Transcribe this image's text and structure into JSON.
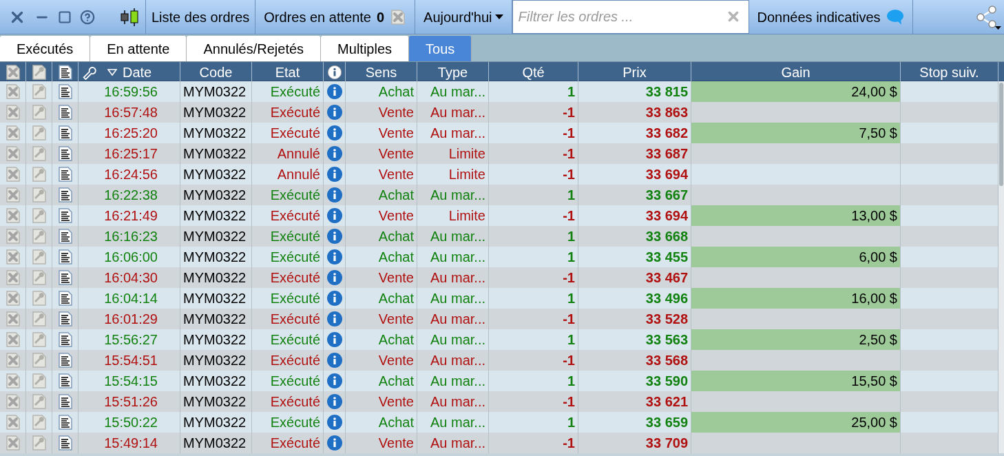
{
  "toolbar": {
    "title": "Liste des ordres",
    "pending_label": "Ordres en attente",
    "pending_count": "0",
    "period": "Aujourd'hui",
    "filter": {
      "placeholder": "Filtrer les ordres ..."
    },
    "data_note": "Données indicatives"
  },
  "tabs": [
    {
      "label": "Exécutés",
      "selected": false
    },
    {
      "label": "En attente",
      "selected": false
    },
    {
      "label": "Annulés/Rejetés",
      "selected": false
    },
    {
      "label": "Multiples",
      "selected": false
    },
    {
      "label": "Tous",
      "selected": true
    }
  ],
  "table": {
    "columns": [
      "Date",
      "Code",
      "Etat",
      "Sens",
      "Type",
      "Qté",
      "Prix",
      "Gain",
      "Stop suiv."
    ],
    "rows": [
      {
        "time": "16:59:56",
        "code": "MYM0322",
        "state": "Exécuté",
        "side": "Achat",
        "type": "Au mar...",
        "qty": "1",
        "price": "33 815",
        "gain": "24,00 $",
        "color": "#11820f"
      },
      {
        "time": "16:57:48",
        "code": "MYM0322",
        "state": "Exécuté",
        "side": "Vente",
        "type": "Au mar...",
        "qty": "-1",
        "price": "33 863",
        "color": "#b0100f"
      },
      {
        "time": "16:25:20",
        "code": "MYM0322",
        "state": "Exécuté",
        "side": "Vente",
        "type": "Au mar...",
        "qty": "-1",
        "price": "33 682",
        "gain": "7,50 $",
        "color": "#b0100f"
      },
      {
        "time": "16:25:17",
        "code": "MYM0322",
        "state": "Annulé",
        "side": "Vente",
        "type": "Limite",
        "qty": "-1",
        "price": "33 687",
        "color": "#b0100f"
      },
      {
        "time": "16:24:56",
        "code": "MYM0322",
        "state": "Annulé",
        "side": "Vente",
        "type": "Limite",
        "qty": "-1",
        "price": "33 694",
        "color": "#b0100f"
      },
      {
        "time": "16:22:38",
        "code": "MYM0322",
        "state": "Exécuté",
        "side": "Achat",
        "type": "Au mar...",
        "qty": "1",
        "price": "33 667",
        "color": "#11820f"
      },
      {
        "time": "16:21:49",
        "code": "MYM0322",
        "state": "Exécuté",
        "side": "Vente",
        "type": "Limite",
        "qty": "-1",
        "price": "33 694",
        "gain": "13,00 $",
        "color": "#b0100f"
      },
      {
        "time": "16:16:23",
        "code": "MYM0322",
        "state": "Exécuté",
        "side": "Achat",
        "type": "Au mar...",
        "qty": "1",
        "price": "33 668",
        "color": "#11820f"
      },
      {
        "time": "16:06:00",
        "code": "MYM0322",
        "state": "Exécuté",
        "side": "Achat",
        "type": "Au mar...",
        "qty": "1",
        "price": "33 455",
        "gain": "6,00 $",
        "color": "#11820f"
      },
      {
        "time": "16:04:30",
        "code": "MYM0322",
        "state": "Exécuté",
        "side": "Vente",
        "type": "Au mar...",
        "qty": "-1",
        "price": "33 467",
        "color": "#b0100f"
      },
      {
        "time": "16:04:14",
        "code": "MYM0322",
        "state": "Exécuté",
        "side": "Achat",
        "type": "Au mar...",
        "qty": "1",
        "price": "33 496",
        "gain": "16,00 $",
        "color": "#11820f"
      },
      {
        "time": "16:01:29",
        "code": "MYM0322",
        "state": "Exécuté",
        "side": "Vente",
        "type": "Au mar...",
        "qty": "-1",
        "price": "33 528",
        "color": "#b0100f"
      },
      {
        "time": "15:56:27",
        "code": "MYM0322",
        "state": "Exécuté",
        "side": "Achat",
        "type": "Au mar...",
        "qty": "1",
        "price": "33 563",
        "gain": "2,50 $",
        "color": "#11820f"
      },
      {
        "time": "15:54:51",
        "code": "MYM0322",
        "state": "Exécuté",
        "side": "Vente",
        "type": "Au mar...",
        "qty": "-1",
        "price": "33 568",
        "color": "#b0100f"
      },
      {
        "time": "15:54:15",
        "code": "MYM0322",
        "state": "Exécuté",
        "side": "Achat",
        "type": "Au mar...",
        "qty": "1",
        "price": "33 590",
        "gain": "15,50 $",
        "color": "#11820f"
      },
      {
        "time": "15:51:26",
        "code": "MYM0322",
        "state": "Exécuté",
        "side": "Vente",
        "type": "Au mar...",
        "qty": "-1",
        "price": "33 621",
        "color": "#b0100f"
      },
      {
        "time": "15:50:22",
        "code": "MYM0322",
        "state": "Exécuté",
        "side": "Achat",
        "type": "Au mar...",
        "qty": "1",
        "price": "33 659",
        "gain": "25,00 $",
        "color": "#11820f"
      },
      {
        "time": "15:49:14",
        "code": "MYM0322",
        "state": "Exécuté",
        "side": "Vente",
        "type": "Au mar...",
        "qty": "-1",
        "price": "33 709",
        "color": "#b0100f"
      }
    ]
  }
}
